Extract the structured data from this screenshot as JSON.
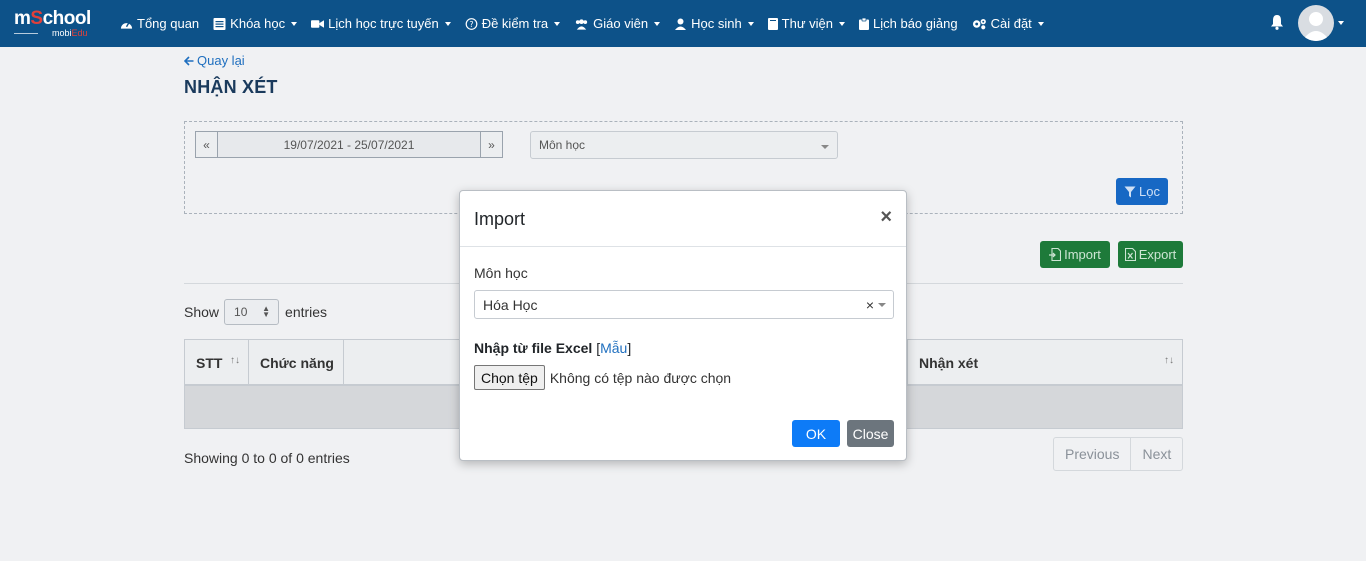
{
  "brand": {
    "logo_main_prefix": "m",
    "logo_main_o": "S",
    "logo_main_rest": "chool",
    "logo_sub_a": "mobi",
    "logo_sub_b": "Edu"
  },
  "nav": [
    {
      "label": "Tổng quan",
      "icon": "dashboard-icon",
      "dropdown": false
    },
    {
      "label": "Khóa học",
      "icon": "list-icon",
      "dropdown": true
    },
    {
      "label": "Lịch học trực tuyến",
      "icon": "video-icon",
      "dropdown": true
    },
    {
      "label": "Đề kiểm tra",
      "icon": "question-icon",
      "dropdown": true
    },
    {
      "label": "Giáo viên",
      "icon": "users-icon",
      "dropdown": true
    },
    {
      "label": "Học sinh",
      "icon": "user-icon",
      "dropdown": true
    },
    {
      "label": "Thư viện",
      "icon": "book-icon",
      "dropdown": true
    },
    {
      "label": "Lịch báo giảng",
      "icon": "clipboard-icon",
      "dropdown": false
    },
    {
      "label": "Cài đặt",
      "icon": "cogs-icon",
      "dropdown": true
    }
  ],
  "page": {
    "back_label": "Quay lại",
    "title": "NHẬN XÉT",
    "date_range": "19/07/2021 - 25/07/2021",
    "prev_arrow": "«",
    "next_arrow": "»",
    "subject_placeholder": "Môn học",
    "filter_label": "Lọc",
    "import_label": "Import",
    "export_label": "Export",
    "show_label": "Show",
    "entries_label": "entries",
    "page_length": "10",
    "columns": [
      "STT",
      "Chức năng",
      "Nhận xét"
    ],
    "info": "Showing 0 to 0 of 0 entries",
    "previous": "Previous",
    "next": "Next"
  },
  "modal": {
    "title": "Import",
    "close_glyph": "×",
    "subject_label": "Môn học",
    "subject_value": "Hóa Học",
    "clear_glyph": "×",
    "excel_label": "Nhập từ file Excel",
    "template_open": "[",
    "template_link": "Mẫu",
    "template_close": "]",
    "choose_file": "Chọn tệp",
    "no_file": "Không có tệp nào được chọn",
    "ok": "OK",
    "close": "Close"
  },
  "colors": {
    "navbar": "#0d5289",
    "primary": "#0d7bf7",
    "success": "#1e7a3a",
    "secondary": "#6c757d"
  }
}
